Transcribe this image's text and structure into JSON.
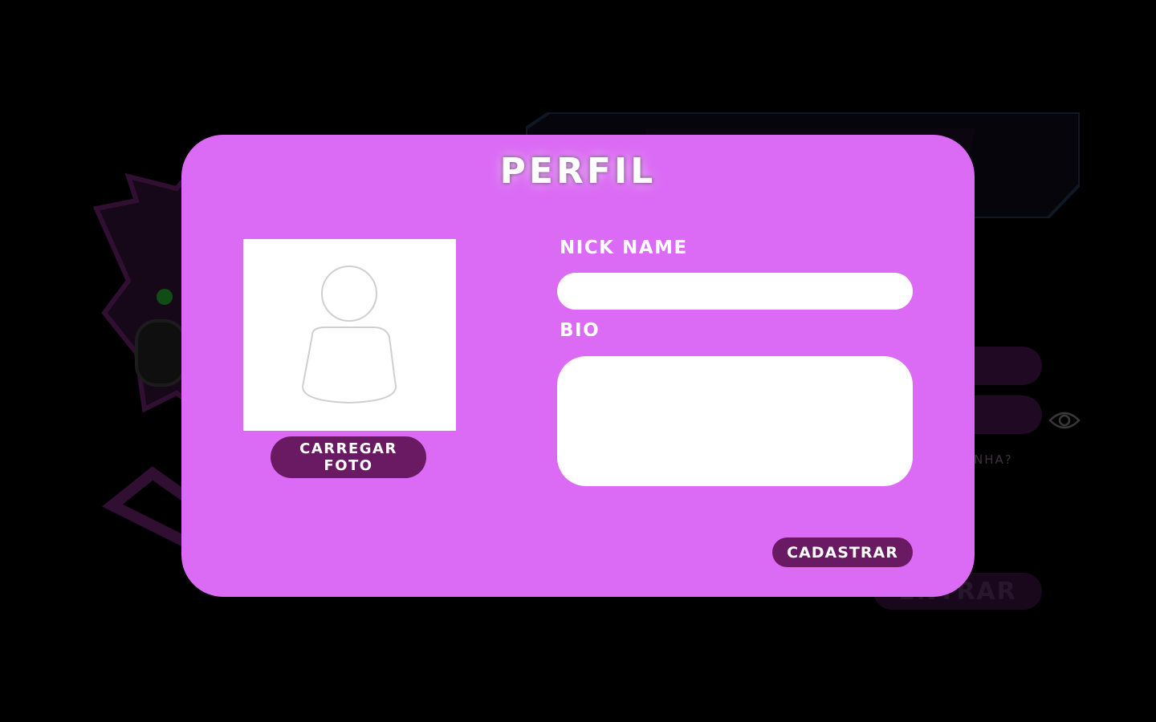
{
  "modal": {
    "title": "PERFIL",
    "photo": {
      "placeholder_icon": "avatar-placeholder-icon",
      "upload_button": [
        "CARREGAR",
        "FOTO"
      ]
    },
    "fields": {
      "nick_label": "NICK NAME",
      "nick_value": "",
      "bio_label": "BIO",
      "bio_value": ""
    },
    "submit_label": "CADASTRAR"
  },
  "background": {
    "forgot_fragment": "SENHA?",
    "enter_label": "ENTRAR",
    "eye_icon": "eye-icon",
    "logo_icon": "gamer-mascot-logo-icon"
  },
  "colors": {
    "modal_bg": "#db6bf4",
    "button_bg": "#6a1a63",
    "page_bg": "#000000"
  }
}
